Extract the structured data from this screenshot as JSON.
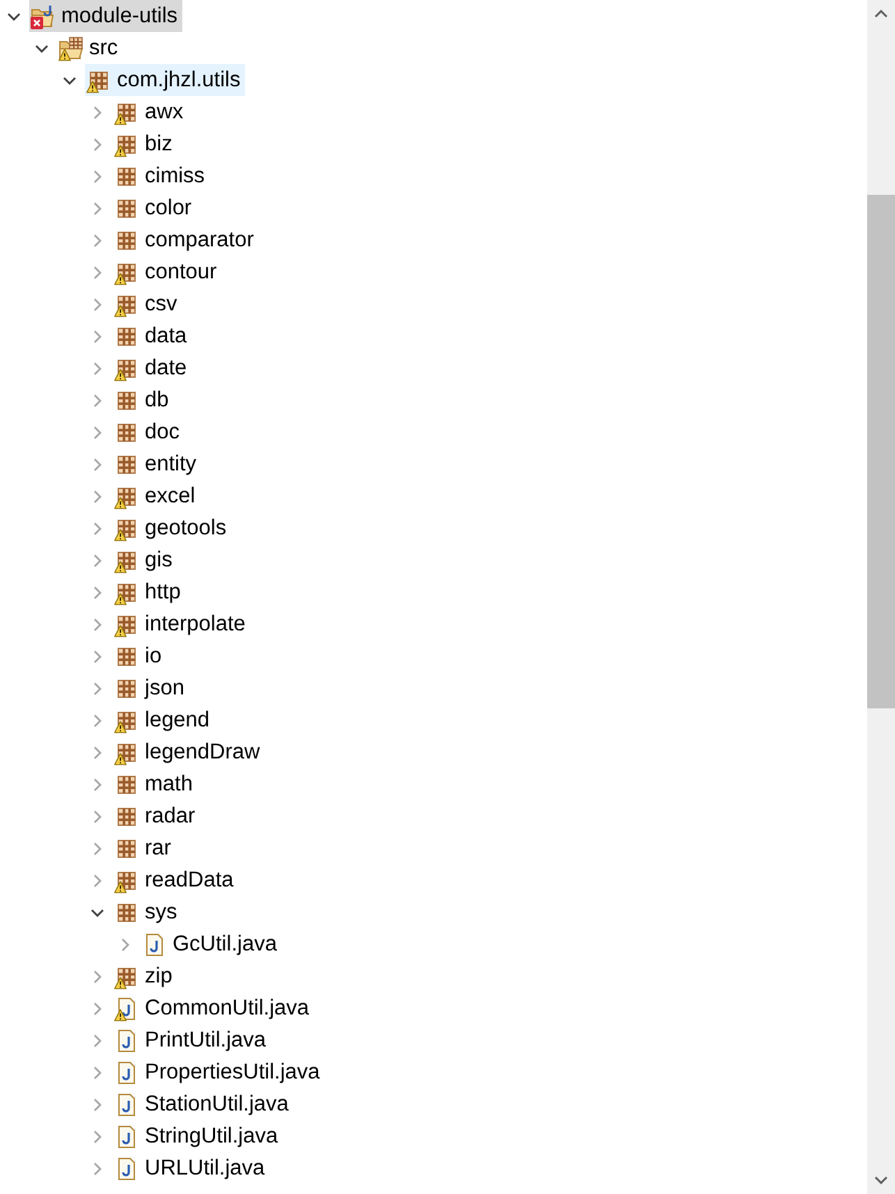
{
  "tree": [
    {
      "label": "module-utils",
      "kind": "project",
      "error": true,
      "warning": false,
      "expanded": true,
      "selected": true,
      "hovered": false,
      "children": [
        {
          "label": "src",
          "kind": "source-folder",
          "error": false,
          "warning": true,
          "expanded": true,
          "selected": false,
          "hovered": false,
          "children": [
            {
              "label": "com.jhzl.utils",
              "kind": "package",
              "error": false,
              "warning": true,
              "expanded": true,
              "selected": false,
              "hovered": true,
              "children": [
                {
                  "label": "awx",
                  "kind": "package",
                  "error": false,
                  "warning": true,
                  "expanded": false,
                  "selected": false,
                  "hovered": false
                },
                {
                  "label": "biz",
                  "kind": "package",
                  "error": false,
                  "warning": true,
                  "expanded": false,
                  "selected": false,
                  "hovered": false
                },
                {
                  "label": "cimiss",
                  "kind": "package",
                  "error": false,
                  "warning": false,
                  "expanded": false,
                  "selected": false,
                  "hovered": false
                },
                {
                  "label": "color",
                  "kind": "package",
                  "error": false,
                  "warning": false,
                  "expanded": false,
                  "selected": false,
                  "hovered": false
                },
                {
                  "label": "comparator",
                  "kind": "package",
                  "error": false,
                  "warning": false,
                  "expanded": false,
                  "selected": false,
                  "hovered": false
                },
                {
                  "label": "contour",
                  "kind": "package",
                  "error": false,
                  "warning": true,
                  "expanded": false,
                  "selected": false,
                  "hovered": false
                },
                {
                  "label": "csv",
                  "kind": "package",
                  "error": false,
                  "warning": true,
                  "expanded": false,
                  "selected": false,
                  "hovered": false
                },
                {
                  "label": "data",
                  "kind": "package",
                  "error": false,
                  "warning": false,
                  "expanded": false,
                  "selected": false,
                  "hovered": false
                },
                {
                  "label": "date",
                  "kind": "package",
                  "error": false,
                  "warning": true,
                  "expanded": false,
                  "selected": false,
                  "hovered": false
                },
                {
                  "label": "db",
                  "kind": "package",
                  "error": false,
                  "warning": false,
                  "expanded": false,
                  "selected": false,
                  "hovered": false
                },
                {
                  "label": "doc",
                  "kind": "package",
                  "error": false,
                  "warning": false,
                  "expanded": false,
                  "selected": false,
                  "hovered": false
                },
                {
                  "label": "entity",
                  "kind": "package",
                  "error": false,
                  "warning": false,
                  "expanded": false,
                  "selected": false,
                  "hovered": false
                },
                {
                  "label": "excel",
                  "kind": "package",
                  "error": false,
                  "warning": true,
                  "expanded": false,
                  "selected": false,
                  "hovered": false
                },
                {
                  "label": "geotools",
                  "kind": "package",
                  "error": false,
                  "warning": true,
                  "expanded": false,
                  "selected": false,
                  "hovered": false
                },
                {
                  "label": "gis",
                  "kind": "package",
                  "error": false,
                  "warning": true,
                  "expanded": false,
                  "selected": false,
                  "hovered": false
                },
                {
                  "label": "http",
                  "kind": "package",
                  "error": false,
                  "warning": true,
                  "expanded": false,
                  "selected": false,
                  "hovered": false
                },
                {
                  "label": "interpolate",
                  "kind": "package",
                  "error": false,
                  "warning": true,
                  "expanded": false,
                  "selected": false,
                  "hovered": false
                },
                {
                  "label": "io",
                  "kind": "package",
                  "error": false,
                  "warning": false,
                  "expanded": false,
                  "selected": false,
                  "hovered": false
                },
                {
                  "label": "json",
                  "kind": "package",
                  "error": false,
                  "warning": false,
                  "expanded": false,
                  "selected": false,
                  "hovered": false
                },
                {
                  "label": "legend",
                  "kind": "package",
                  "error": false,
                  "warning": true,
                  "expanded": false,
                  "selected": false,
                  "hovered": false
                },
                {
                  "label": "legendDraw",
                  "kind": "package",
                  "error": false,
                  "warning": true,
                  "expanded": false,
                  "selected": false,
                  "hovered": false
                },
                {
                  "label": "math",
                  "kind": "package",
                  "error": false,
                  "warning": false,
                  "expanded": false,
                  "selected": false,
                  "hovered": false
                },
                {
                  "label": "radar",
                  "kind": "package",
                  "error": false,
                  "warning": false,
                  "expanded": false,
                  "selected": false,
                  "hovered": false
                },
                {
                  "label": "rar",
                  "kind": "package",
                  "error": false,
                  "warning": false,
                  "expanded": false,
                  "selected": false,
                  "hovered": false
                },
                {
                  "label": "readData",
                  "kind": "package",
                  "error": false,
                  "warning": true,
                  "expanded": false,
                  "selected": false,
                  "hovered": false
                },
                {
                  "label": "sys",
                  "kind": "package",
                  "error": false,
                  "warning": false,
                  "expanded": true,
                  "selected": false,
                  "hovered": false,
                  "children": [
                    {
                      "label": "GcUtil.java",
                      "kind": "java-file",
                      "error": false,
                      "warning": false,
                      "expanded": false,
                      "selected": false,
                      "hovered": false
                    }
                  ]
                },
                {
                  "label": "zip",
                  "kind": "package",
                  "error": false,
                  "warning": true,
                  "expanded": false,
                  "selected": false,
                  "hovered": false
                },
                {
                  "label": "CommonUtil.java",
                  "kind": "java-file",
                  "error": false,
                  "warning": true,
                  "expanded": false,
                  "selected": false,
                  "hovered": false
                },
                {
                  "label": "PrintUtil.java",
                  "kind": "java-file",
                  "error": false,
                  "warning": false,
                  "expanded": false,
                  "selected": false,
                  "hovered": false
                },
                {
                  "label": "PropertiesUtil.java",
                  "kind": "java-file",
                  "error": false,
                  "warning": false,
                  "expanded": false,
                  "selected": false,
                  "hovered": false
                },
                {
                  "label": "StationUtil.java",
                  "kind": "java-file",
                  "error": false,
                  "warning": false,
                  "expanded": false,
                  "selected": false,
                  "hovered": false
                },
                {
                  "label": "StringUtil.java",
                  "kind": "java-file",
                  "error": false,
                  "warning": false,
                  "expanded": false,
                  "selected": false,
                  "hovered": false
                },
                {
                  "label": "URLUtil.java",
                  "kind": "java-file",
                  "error": false,
                  "warning": false,
                  "expanded": false,
                  "selected": false,
                  "hovered": false
                }
              ]
            }
          ]
        }
      ]
    }
  ]
}
